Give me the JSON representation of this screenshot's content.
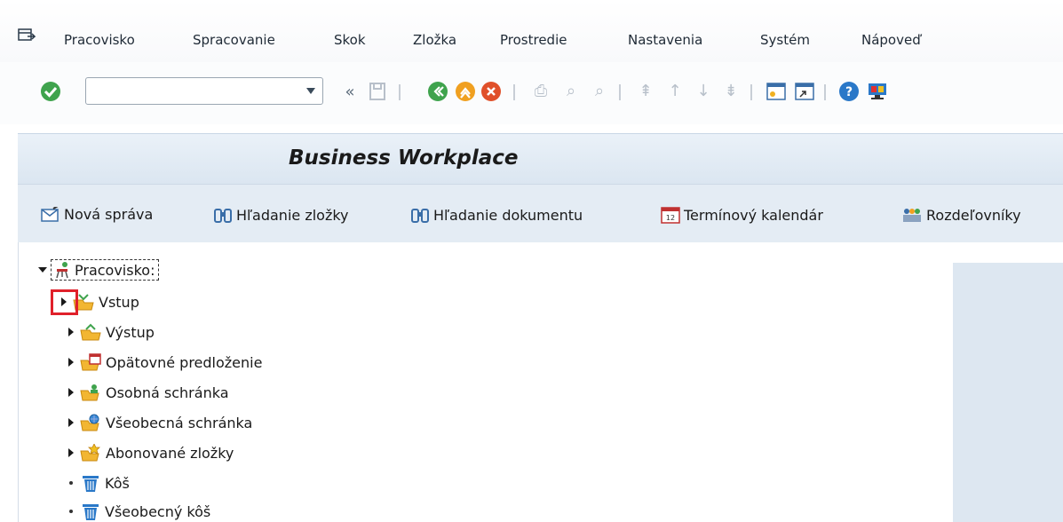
{
  "menu": {
    "items": [
      "Pracovisko",
      "Spracovanie",
      "Skok",
      "Zložka",
      "Prostredie",
      "Nastavenia",
      "Systém",
      "Nápoveď"
    ]
  },
  "toolbar": {
    "command_value": "",
    "icons": [
      "enter-icon",
      "back-double-icon",
      "save-icon",
      "back-icon",
      "exit-icon",
      "cancel-icon",
      "print-icon",
      "find-icon",
      "find-next-icon",
      "first-page-icon",
      "prev-page-icon",
      "next-page-icon",
      "last-page-icon",
      "new-session-icon",
      "shortcut-icon",
      "help-icon",
      "customize-icon"
    ]
  },
  "title": "Business Workplace",
  "app_toolbar": {
    "new_message": "Nová správa",
    "find_folder": "Hľadanie zložky",
    "find_document": "Hľadanie dokumentu",
    "calendar": "Termínový kalendár",
    "distribution": "Rozdeľovníky"
  },
  "tree": {
    "root": "Pracovisko:",
    "nodes": [
      {
        "label": "Vstup",
        "icon": "inbox-icon"
      },
      {
        "label": "Výstup",
        "icon": "outbox-icon"
      },
      {
        "label": "Opätovné predloženie",
        "icon": "resubmission-icon"
      },
      {
        "label": "Osobná schránka",
        "icon": "private-folder-icon"
      },
      {
        "label": "Všeobecná schránka",
        "icon": "shared-folder-icon"
      },
      {
        "label": "Abonované zložky",
        "icon": "subscribed-folder-icon"
      },
      {
        "label": "Kôš",
        "icon": "trash-icon"
      },
      {
        "label": "Všeobecný kôš",
        "icon": "shared-trash-icon"
      }
    ]
  },
  "colors": {
    "highlight": "#e0202a",
    "title_bg": "#dbe6f1",
    "toolbar_bg": "#e4ecf4"
  }
}
